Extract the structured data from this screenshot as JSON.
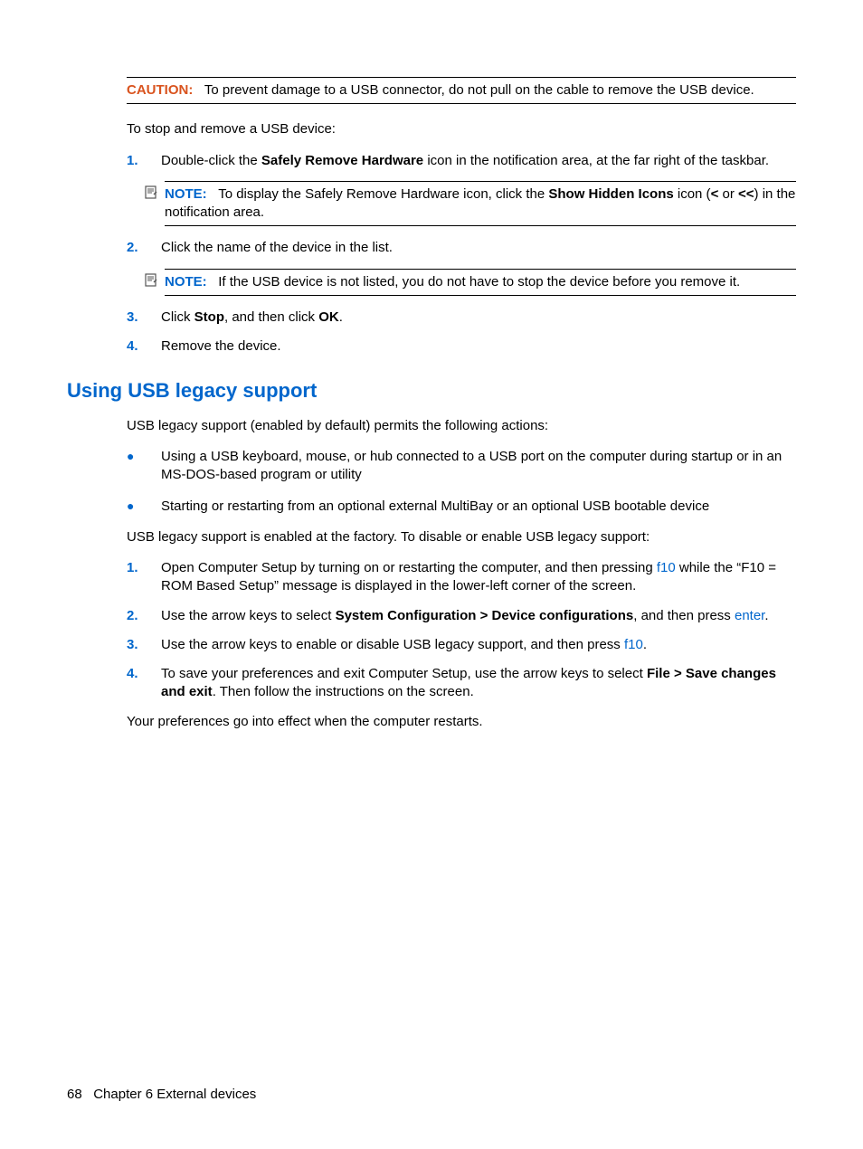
{
  "caution": {
    "label": "CAUTION:",
    "text": "To prevent damage to a USB connector, do not pull on the cable to remove the USB device."
  },
  "intro": "To stop and remove a USB device:",
  "steps1": [
    {
      "num": "1.",
      "pre": "Double-click the ",
      "bold": "Safely Remove Hardware",
      "post": " icon in the notification area, at the far right of the taskbar."
    }
  ],
  "note1": {
    "label": "NOTE:",
    "pre": "To display the Safely Remove Hardware icon, click the ",
    "bold1": "Show Hidden Icons",
    "mid": " icon (",
    "bold2": "<",
    "mid2": " or ",
    "bold3": "<<",
    "post": ") in the notification area."
  },
  "steps2": [
    {
      "num": "2.",
      "text": "Click the name of the device in the list."
    }
  ],
  "note2": {
    "label": "NOTE:",
    "text": "If the USB device is not listed, you do not have to stop the device before you remove it."
  },
  "steps3": [
    {
      "num": "3.",
      "pre": "Click ",
      "bold1": "Stop",
      "mid": ", and then click ",
      "bold2": "OK",
      "post": "."
    },
    {
      "num": "4.",
      "text": "Remove the device."
    }
  ],
  "section2": {
    "title": "Using USB legacy support",
    "intro": "USB legacy support (enabled by default) permits the following actions:",
    "bullets": [
      "Using a USB keyboard, mouse, or hub connected to a USB port on the computer during startup or in an MS-DOS-based program or utility",
      "Starting or restarting from an optional external MultiBay or an optional USB bootable device"
    ],
    "para2": "USB legacy support is enabled at the factory. To disable or enable USB legacy support:",
    "ol": [
      {
        "num": "1.",
        "pre": "Open Computer Setup by turning on or restarting the computer, and then pressing ",
        "key": "f10",
        "post": " while the “F10 = ROM Based Setup” message is displayed in the lower-left corner of the screen."
      },
      {
        "num": "2.",
        "pre": "Use the arrow keys to select ",
        "bold": "System Configuration > Device configurations",
        "mid": ", and then press ",
        "key": "enter",
        "post": "."
      },
      {
        "num": "3.",
        "pre": "Use the arrow keys to enable or disable USB legacy support, and then press ",
        "key": "f10",
        "post": "."
      },
      {
        "num": "4.",
        "pre": "To save your preferences and exit Computer Setup, use the arrow keys to select ",
        "bold": "File > Save changes and exit",
        "post": ". Then follow the instructions on the screen."
      }
    ],
    "closing": "Your preferences go into effect when the computer restarts."
  },
  "footer": {
    "page": "68",
    "chapter": "Chapter 6   External devices"
  }
}
